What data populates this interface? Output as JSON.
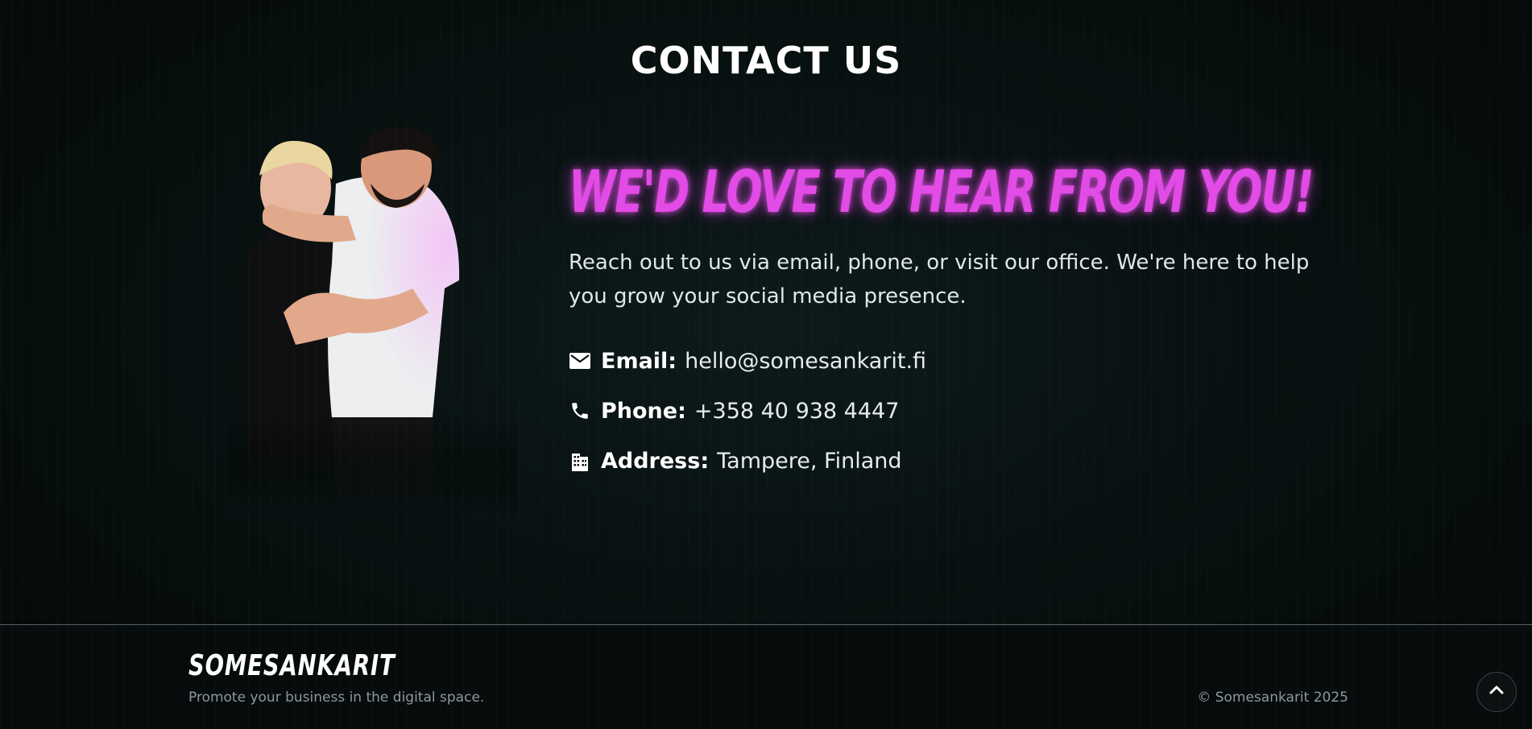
{
  "section": {
    "title": "CONTACT US"
  },
  "contact": {
    "headline": "WE'D LOVE TO HEAR FROM YOU!",
    "intro": "Reach out to us via email, phone, or visit our office. We're here to help you grow your social media presence.",
    "items": [
      {
        "icon": "mail-icon",
        "label": "Email:",
        "value": "hello@somesankarit.fi"
      },
      {
        "icon": "phone-icon",
        "label": "Phone:",
        "value": "+358 40 938 4447"
      },
      {
        "icon": "building-icon",
        "label": "Address:",
        "value": "Tampere, Finland"
      }
    ]
  },
  "footer": {
    "brand": "SOMESANKARIT",
    "tagline": "Promote your business in the digital space.",
    "copyright": "© Somesankarit 2025"
  },
  "colors": {
    "accent": "#e24be6",
    "background": "#050a0a",
    "text": "#e9eef0",
    "muted": "#8f989a"
  }
}
